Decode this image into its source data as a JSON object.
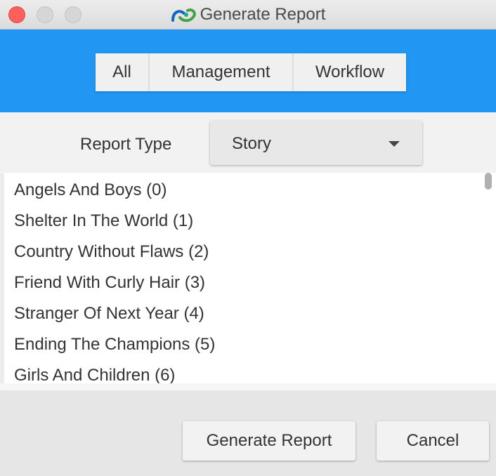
{
  "window": {
    "title": "Generate Report",
    "icon": "app-logo-icon"
  },
  "category_tabs": [
    {
      "label": "All"
    },
    {
      "label": "Management"
    },
    {
      "label": "Workflow"
    }
  ],
  "report_type": {
    "label": "Report Type",
    "selected": "Story"
  },
  "reports": [
    {
      "label": "Angels And Boys (0)"
    },
    {
      "label": "Shelter In The World (1)"
    },
    {
      "label": "Country Without Flaws (2)"
    },
    {
      "label": "Friend With Curly Hair (3)"
    },
    {
      "label": "Stranger Of Next Year (4)"
    },
    {
      "label": "Ending The Champions (5)"
    },
    {
      "label": "Girls And Children (6)"
    }
  ],
  "actions": {
    "generate_label": "Generate Report",
    "cancel_label": "Cancel"
  },
  "colors": {
    "accent": "#2196f3",
    "close": "#fc605c"
  }
}
